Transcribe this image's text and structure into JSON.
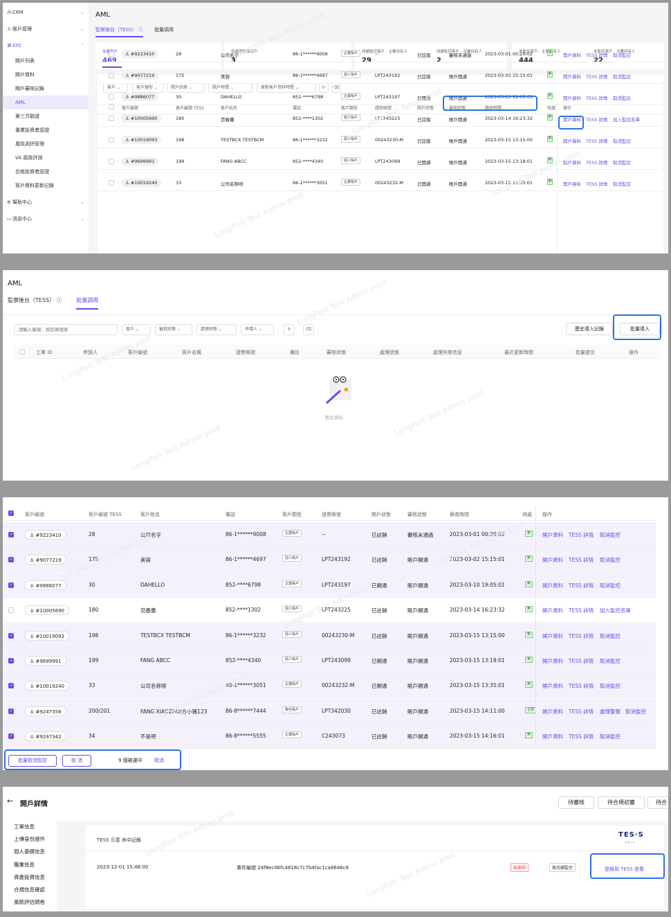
{
  "s1": {
    "sidebar": [
      {
        "label": "CRM",
        "icon": "crm-icon"
      },
      {
        "label": "賬戶管理",
        "icon": "user-icon"
      },
      {
        "label": "KYC",
        "icon": "kyc-icon"
      },
      {
        "label": "開戶列表"
      },
      {
        "label": "開戶資料"
      },
      {
        "label": "開戶審核記錄"
      },
      {
        "label": "AML"
      },
      {
        "label": "第三方驗證"
      },
      {
        "label": "專業投資者認證"
      },
      {
        "label": "風險測評管理"
      },
      {
        "label": "VA 風險評測"
      },
      {
        "label": "合格投資者認證"
      },
      {
        "label": "客戶資料更新記錄"
      },
      {
        "label": "幫助中心",
        "icon": "help-icon"
      },
      {
        "label": "消息中心",
        "icon": "message-icon"
      }
    ],
    "title": "AML",
    "tab_active": "監察後台（TESS）",
    "tab_other": "批量調用",
    "cards": [
      {
        "label": "全量客戶",
        "value": "469"
      },
      {
        "label": "待處理警報客戶",
        "value": "3"
      },
      {
        "label": "持續監控客戶 - 主要持有人",
        "value": "29"
      },
      {
        "label": "持續監控客戶 - 次要持有人",
        "value": "2"
      },
      {
        "label": "未監控客戶 - 主要持有人",
        "value": "444"
      },
      {
        "label": "未監控客戶 - 次要持有人",
        "value": "22"
      }
    ],
    "filters": [
      "客戶 ⌄",
      "客戶類型 ⌄",
      "開戶狀態 ⌄",
      "開戶時間 ⌄",
      "更新客戶資料時間 ⌄"
    ],
    "headers": [
      "客戶編號",
      "客戶編號 TESS",
      "客戶姓名",
      "電話",
      "客戶類型",
      "證券賬號",
      "開戶狀態",
      "審核狀態",
      "篩查時間",
      "待處",
      "操作"
    ],
    "rows": [
      [
        "#9223410",
        "28",
        "公司名字",
        "86-1******9008",
        "企業賬戶",
        "--",
        "已註銷",
        "審核未通過",
        "2023-03-01 00:20:02",
        "無",
        "開戶資料",
        "TESS 詳情",
        "取消監控"
      ],
      [
        "#9077219",
        "175",
        "美容",
        "86-1******4697",
        "個人賬戶",
        "LPT243192",
        "已註銷",
        "賬戶開通",
        "2023-03-02 15:15:01",
        "無",
        "開戶資料",
        "TESS 詳情",
        "取消監控"
      ],
      [
        "#9886077",
        "30",
        "DAHELLO",
        "852-****6798",
        "企業賬戶",
        "LPT243197",
        "已開通",
        "賬戶開通",
        "2023-03-10 19:05:01",
        "無",
        "開戶資料",
        "TESS 詳情",
        "取消監控"
      ],
      [
        "#10005690",
        "180",
        "范春蕾",
        "852-****1302",
        "個人賬戶",
        "LPT243225",
        "已註銷",
        "賬戶開通",
        "2023-03-14 16:23:32",
        "無",
        "開戶資料",
        "TESS 詳情",
        "加入監控名單"
      ],
      [
        "#10019093",
        "198",
        "TESTBCX TESTBCM",
        "86-1******3232",
        "個人賬戶",
        "00243230-M",
        "已註銷",
        "賬戶開通",
        "2023-03-15 13:15:00",
        "無",
        "開戶資料",
        "TESS 詳情",
        "取消監控"
      ],
      [
        "#9699991",
        "199",
        "FANG ABCC",
        "852-****4340",
        "個人賬戶",
        "LPT243099",
        "已開通",
        "賬戶開通",
        "2023-03-15 13:18:01",
        "無",
        "開戶資料",
        "TESS 詳情",
        "取消監控"
      ],
      [
        "#10019240",
        "33",
        "公司名称呀",
        "86-1******3051",
        "企業賬戶",
        "00243232-M",
        "已開通",
        "賬戶開通",
        "2023-03-15 13:35:01",
        "無",
        "開戶資料",
        "TESS 詳情",
        "取消監控"
      ]
    ]
  },
  "s2": {
    "title": "AML",
    "tab_active": "批量調用",
    "tab_other": "監察後台（TESS）",
    "search_placeholder": "請輸入編號、按回車搜索",
    "filters": [
      "客戶 ⌄",
      "審批狀態 ⌄",
      "處理狀態 ⌄",
      "申請人 ⌄"
    ],
    "btn_history": "歷史導入記錄",
    "btn_import": "批量導入",
    "headers": [
      "工單 ID",
      "申請人",
      "客戶編號",
      "客戶名稱",
      "證券賬號",
      "備註",
      "審核狀態",
      "處理狀態",
      "處理失敗信息",
      "最近更新時間",
      "批量提交",
      "操作"
    ],
    "empty": "暫此資料"
  },
  "s3": {
    "headers": [
      "客戶編號",
      "客戶編號 TESS",
      "客戶姓名",
      "電話",
      "客戶類型",
      "證券賬號",
      "開戶狀態",
      "審核狀態",
      "篩查時間",
      "待處",
      "操作"
    ],
    "rows": [
      {
        "sel": true,
        "c": [
          "#9223410",
          "28",
          "公司名字",
          "86-1******9008",
          "企業賬戶",
          "--",
          "已註銷",
          "審核未通過",
          "2023-03-01 00:20:02",
          "無"
        ],
        "a": [
          "開戶資料",
          "TESS 詳情",
          "取消監控"
        ]
      },
      {
        "sel": true,
        "c": [
          "#9077219",
          "175",
          "美容",
          "86-1******4697",
          "個人賬戶",
          "LPT243192",
          "已註銷",
          "賬戶開通",
          "2023-03-02 15:15:01",
          "無"
        ],
        "a": [
          "開戶資料",
          "TESS 詳情",
          "取消監控"
        ]
      },
      {
        "sel": true,
        "c": [
          "#9886077",
          "30",
          "DAHELLO",
          "852-****6798",
          "企業賬戶",
          "LPT243197",
          "已開通",
          "賬戶開通",
          "2023-03-10 19:05:01",
          "無"
        ],
        "a": [
          "開戶資料",
          "TESS 詳情",
          "取消監控"
        ]
      },
      {
        "sel": false,
        "c": [
          "#10005690",
          "180",
          "范春蕾",
          "852-****1302",
          "個人賬戶",
          "LPT243225",
          "已註銷",
          "賬戶開通",
          "2023-03-14 16:23:32",
          "無"
        ],
        "a": [
          "開戶資料",
          "TESS 詳情",
          "加入監控名單"
        ]
      },
      {
        "sel": true,
        "c": [
          "#10019093",
          "198",
          "TESTBCX TESTBCM",
          "86-1******3232",
          "個人賬戶",
          "00243230-M",
          "已註銷",
          "賬戶開通",
          "2023-03-15 13:15:00",
          "無"
        ],
        "a": [
          "開戶資料",
          "TESS 詳情",
          "取消監控"
        ]
      },
      {
        "sel": true,
        "c": [
          "#9699991",
          "199",
          "FANG ABCC",
          "852-****4340",
          "個人賬戶",
          "LPT243099",
          "已開通",
          "賬戶開通",
          "2023-03-15 13:18:01",
          "無"
        ],
        "a": [
          "開戶資料",
          "TESS 詳情",
          "取消監控"
        ]
      },
      {
        "sel": true,
        "c": [
          "#10019240",
          "33",
          "公司名称呀",
          "86-1******3051",
          "企業賬戶",
          "00243232-M",
          "已開通",
          "賬戶開通",
          "2023-03-15 13:35:01",
          "無"
        ],
        "a": [
          "開戶資料",
          "TESS 詳情",
          "取消監控"
        ]
      },
      {
        "sel": true,
        "c": [
          "#9247356",
          "200/201",
          "FANG XIAOZHU/方小猪123",
          "86-8******7444",
          "聯名賬戶",
          "LPT342030",
          "已註銷",
          "賬戶開通",
          "2023-03-15 14:11:00",
          "主要"
        ],
        "a": [
          "開戶資料",
          "TESS 詳情",
          "處理警報",
          "取消監控"
        ]
      },
      {
        "sel": true,
        "c": [
          "#9247342",
          "34",
          "不是吧",
          "86-8******5555",
          "企業賬戶",
          "C243073",
          "已註銷",
          "賬戶開通",
          "2023-03-15 14:16:01",
          "無"
        ],
        "a": [
          "開戶資料",
          "TESS 詳情",
          "取消監控"
        ]
      }
    ],
    "btn_bulk_cancel": "批量取消監控",
    "btn_cancel": "取 消",
    "selected_text": "9 個被選中",
    "selected_cancel": "取消"
  },
  "s4": {
    "title": "開戶詳情",
    "tabs": [
      "待審核",
      "待合規初審",
      "待合"
    ],
    "side": [
      "工單信息",
      "上傳身份證件",
      "個人基礎信息",
      "職業信息",
      "資產投資信息",
      "合規信息確認",
      "風險評估問卷"
    ],
    "card_title": "TESS 示意 命中記錄",
    "logo": "TES·S",
    "logo_sub": "ASIA",
    "record_time": "2023-12-01 15:48:00",
    "record_event": "事件編號 24f8ec06fc4818c7c7b4fac1ca8846c8",
    "tag_red": "未命中",
    "tag_gray": "無持續監控",
    "link": "登錄到 TESS 查看"
  },
  "watermark": "LongPort Test Admin prod"
}
